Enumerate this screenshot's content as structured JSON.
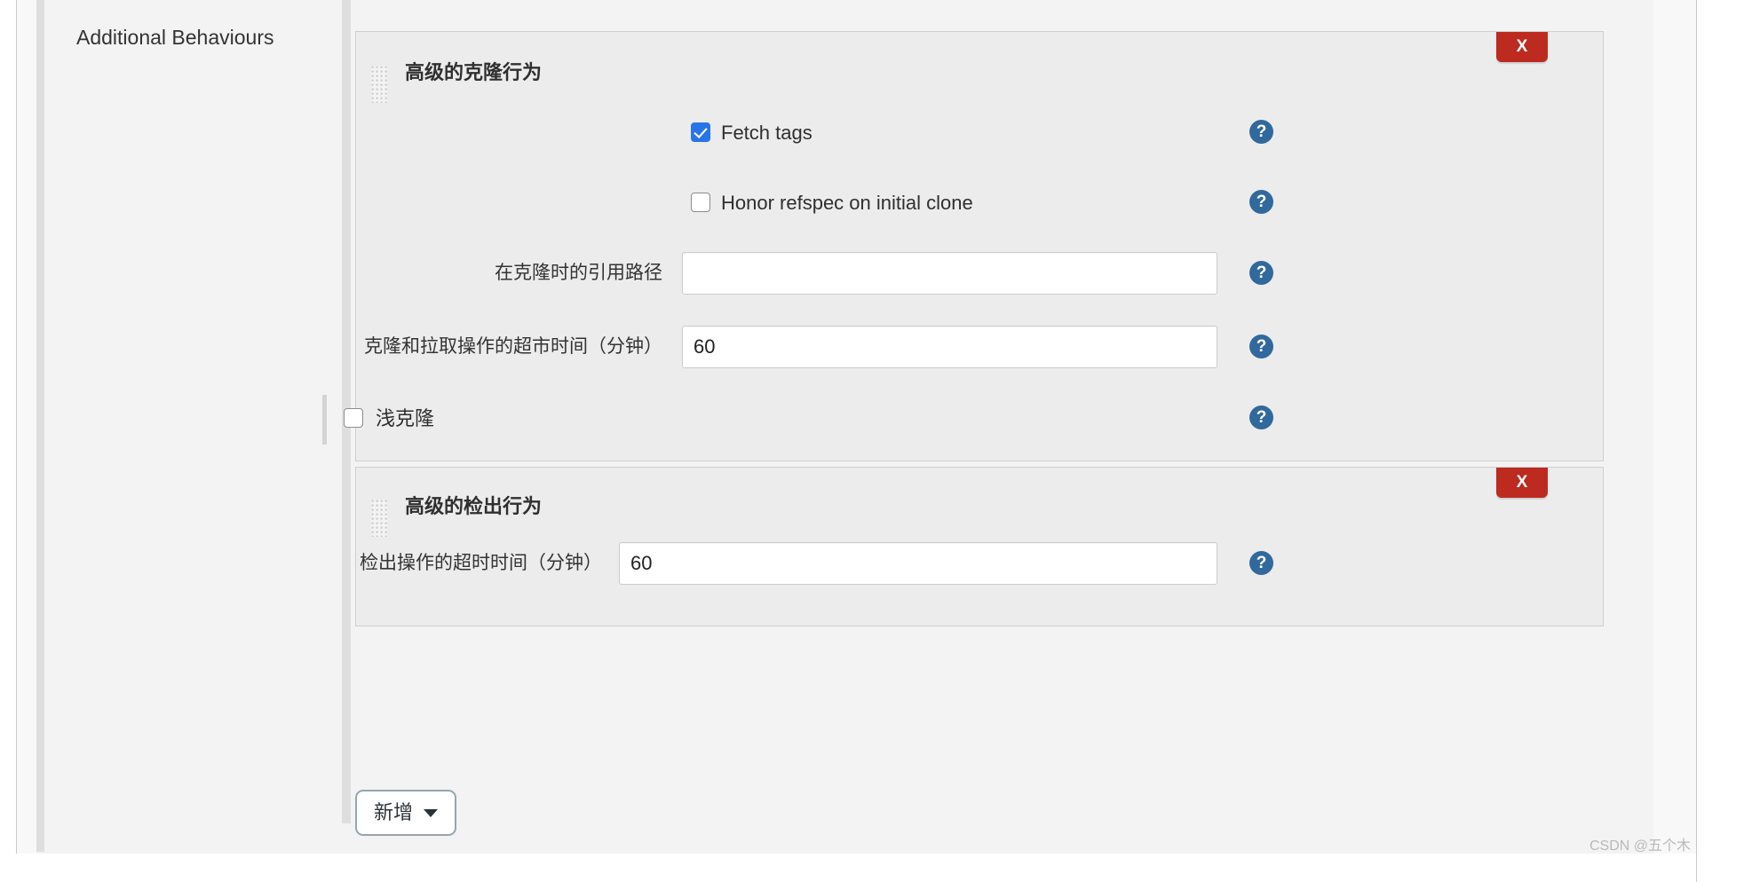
{
  "section": {
    "label": "Additional Behaviours"
  },
  "colors": {
    "canvas_bg": "#f3f3f3",
    "panel_bg": "#ececec",
    "panel_border": "#cfcfcf",
    "delete_red": "#bc2a20",
    "checkbox_blue": "#2a74ea",
    "help_blue": "#31699c",
    "add_button_border": "#97a5ad",
    "rail_grey": "#dedede"
  },
  "panels": [
    {
      "title": "高级的克隆行为",
      "delete_label": "X",
      "grip_icon": "drag-grip-icon",
      "fields": [
        {
          "kind": "checkbox",
          "name": "fetch-tags",
          "label": "Fetch tags",
          "checked": true,
          "help_icon": "help-icon"
        },
        {
          "kind": "checkbox",
          "name": "honor-refspec-on-initial-clone",
          "label": "Honor refspec on initial clone",
          "checked": false,
          "help_icon": "help-icon"
        },
        {
          "kind": "text",
          "name": "reference-path-during-clone",
          "label": "在克隆时的引用路径",
          "value": "",
          "placeholder": "",
          "help_icon": "help-icon"
        },
        {
          "kind": "text",
          "name": "clone-and-fetch-timeout",
          "label": "克隆和拉取操作的超市时间（分钟）",
          "value": "60",
          "placeholder": "",
          "help_icon": "help-icon"
        },
        {
          "kind": "checkbox-nested",
          "name": "shallow-clone",
          "label": "浅克隆",
          "checked": false,
          "help_icon": "help-icon"
        }
      ]
    },
    {
      "title": "高级的检出行为",
      "delete_label": "X",
      "grip_icon": "drag-grip-icon",
      "fields": [
        {
          "kind": "text",
          "name": "checkout-timeout",
          "label": "检出操作的超时时间（分钟）",
          "value": "60",
          "placeholder": "",
          "help_icon": "help-icon"
        }
      ]
    }
  ],
  "add_button": {
    "label": "新增",
    "caret_icon": "caret-down-icon"
  },
  "watermark": {
    "text": "CSDN @五个木"
  },
  "help_glyph": "?"
}
